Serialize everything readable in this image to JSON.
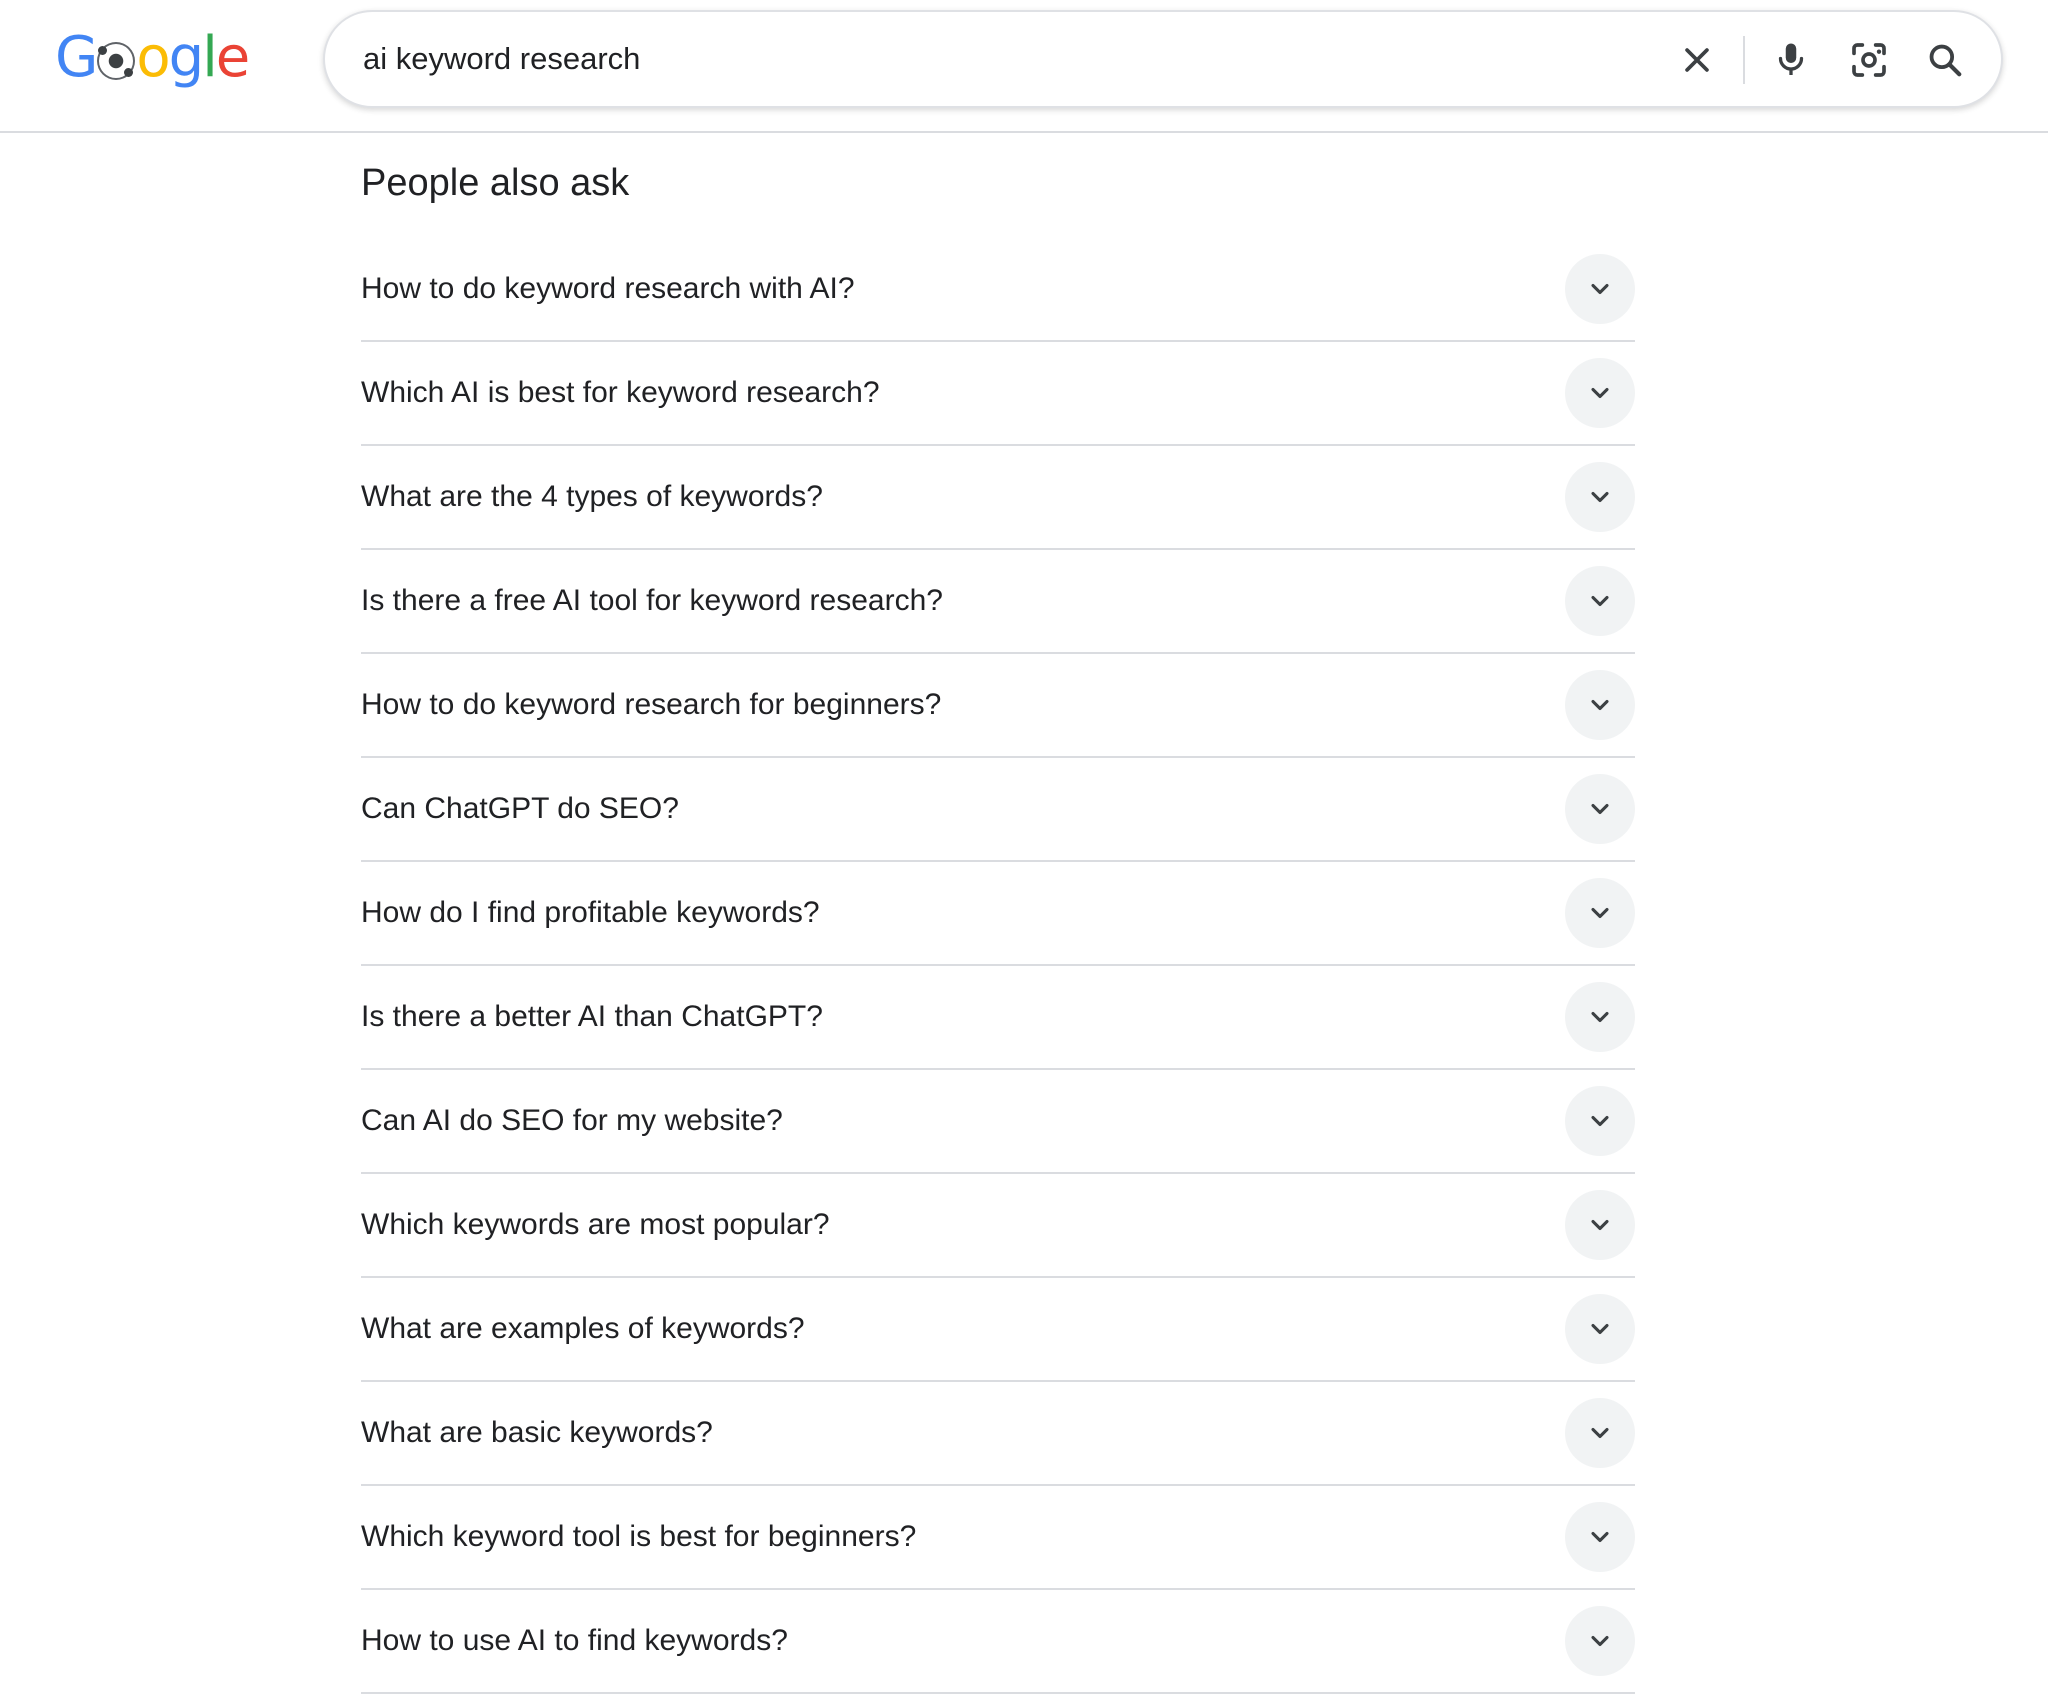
{
  "header": {
    "logo_text": "Google",
    "search": {
      "value": "ai keyword research",
      "clear_icon": "close-icon",
      "voice_icon": "microphone-icon",
      "lens_icon": "camera-lens-icon",
      "search_icon": "search-icon"
    }
  },
  "people_also_ask": {
    "title": "People also ask",
    "expand_icon": "chevron-down-icon",
    "questions": [
      "How to do keyword research with AI?",
      "Which AI is best for keyword research?",
      "What are the 4 types of keywords?",
      "Is there a free AI tool for keyword research?",
      "How to do keyword research for beginners?",
      "Can ChatGPT do SEO?",
      "How do I find profitable keywords?",
      "Is there a better AI than ChatGPT?",
      "Can AI do SEO for my website?",
      "Which keywords are most popular?",
      "What are examples of keywords?",
      "What are basic keywords?",
      "Which keyword tool is best for beginners?",
      "How to use AI to find keywords?"
    ]
  },
  "colors": {
    "text": "#202124",
    "divider": "#dadce0",
    "chevron_bg": "#f1f3f4",
    "icon_grey": "#5f6368",
    "google_blue": "#4285F4",
    "google_red": "#EA4335",
    "google_yellow": "#FBBC05",
    "google_green": "#34A853"
  }
}
